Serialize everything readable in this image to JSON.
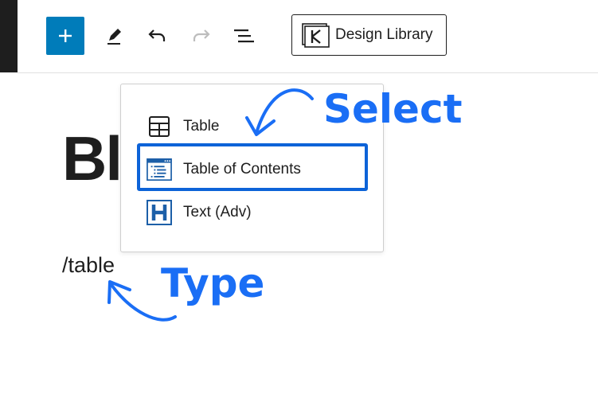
{
  "toolbar": {
    "design_library_label": "Design Library"
  },
  "editor": {
    "heading_text": "Blo",
    "typed_text": "/table"
  },
  "block_menu": {
    "items": [
      {
        "label": "Table",
        "icon": "table-icon"
      },
      {
        "label": "Table of Contents",
        "icon": "table-of-contents-icon"
      },
      {
        "label": "Text (Adv)",
        "icon": "advanced-heading-icon"
      }
    ]
  },
  "annotations": {
    "select_label": "Select",
    "type_label": "Type",
    "accent_color": "#1a6ef5"
  }
}
